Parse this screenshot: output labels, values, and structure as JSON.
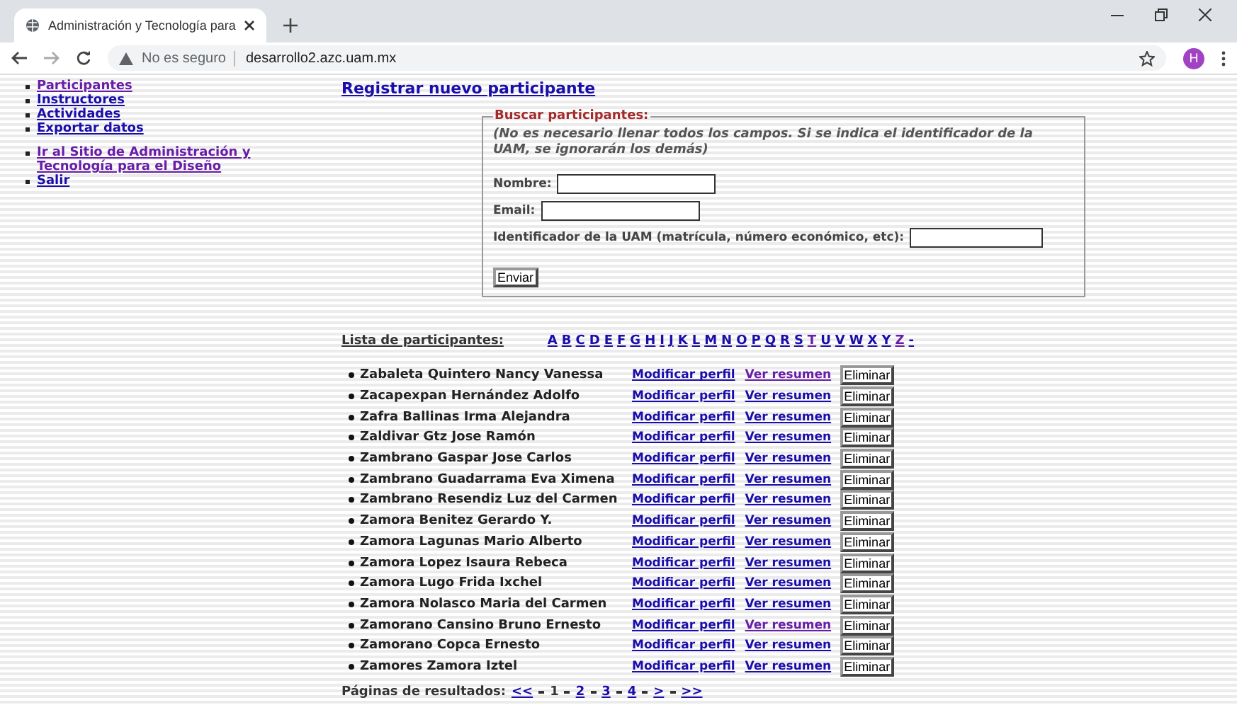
{
  "browser": {
    "tab_title": "Administración y Tecnología para",
    "url_warning": "No es seguro",
    "url": "desarrollo2.azc.uam.mx",
    "profile": "H"
  },
  "nav": {
    "groups": [
      [
        {
          "label": "Participantes",
          "visited": true
        },
        {
          "label": "Instructores",
          "visited": false
        },
        {
          "label": "Actividades",
          "visited": false
        },
        {
          "label": "Exportar datos",
          "visited": false
        }
      ],
      [
        {
          "label": "Ir al Sitio de Administración y Tecnología para el Diseño",
          "visited": true
        },
        {
          "label": "Salir",
          "visited": false
        }
      ]
    ]
  },
  "register_link": "Registrar nuevo participante",
  "search": {
    "legend": "Buscar participantes:",
    "note": "(No es necesario llenar todos los campos. Si se indica el identificador de la UAM, se ignorarán los demás)",
    "fields": [
      {
        "label": "Nombre:"
      },
      {
        "label": "Email:"
      },
      {
        "label": "Identificador de la UAM (matrícula, número económico, etc):"
      }
    ],
    "submit": "Enviar"
  },
  "list_title": "Lista de participantes:",
  "letters": [
    {
      "label": "A",
      "visited": false
    },
    {
      "label": "B",
      "visited": false
    },
    {
      "label": "C",
      "visited": false
    },
    {
      "label": "D",
      "visited": false
    },
    {
      "label": "E",
      "visited": false
    },
    {
      "label": "F",
      "visited": false
    },
    {
      "label": "G",
      "visited": false
    },
    {
      "label": "H",
      "visited": false
    },
    {
      "label": "I",
      "visited": false
    },
    {
      "label": "J",
      "visited": false
    },
    {
      "label": "K",
      "visited": false
    },
    {
      "label": "L",
      "visited": false
    },
    {
      "label": "M",
      "visited": false
    },
    {
      "label": "N",
      "visited": false
    },
    {
      "label": "O",
      "visited": false
    },
    {
      "label": "P",
      "visited": false
    },
    {
      "label": "Q",
      "visited": false
    },
    {
      "label": "R",
      "visited": false
    },
    {
      "label": "S",
      "visited": false
    },
    {
      "label": "T",
      "visited": true
    },
    {
      "label": "U",
      "visited": false
    },
    {
      "label": "V",
      "visited": false
    },
    {
      "label": "W",
      "visited": false
    },
    {
      "label": "X",
      "visited": false
    },
    {
      "label": "Y",
      "visited": false
    },
    {
      "label": "Z",
      "visited": true
    },
    {
      "label": "-",
      "visited": false
    }
  ],
  "participants": [
    {
      "name": "Zabaleta Quintero Nancy Vanessa",
      "edit": "Modificar perfil",
      "summary": "Ver resumen",
      "summary_visited": true,
      "delete": "Eliminar"
    },
    {
      "name": "Zacapexpan Hernández Adolfo",
      "edit": "Modificar perfil",
      "summary": "Ver resumen",
      "summary_visited": false,
      "delete": "Eliminar"
    },
    {
      "name": "Zafra Ballinas Irma Alejandra",
      "edit": "Modificar perfil",
      "summary": "Ver resumen",
      "summary_visited": false,
      "delete": "Eliminar"
    },
    {
      "name": "Zaldivar Gtz Jose Ramón",
      "edit": "Modificar perfil",
      "summary": "Ver resumen",
      "summary_visited": false,
      "delete": "Eliminar"
    },
    {
      "name": "Zambrano Gaspar Jose Carlos",
      "edit": "Modificar perfil",
      "summary": "Ver resumen",
      "summary_visited": false,
      "delete": "Eliminar"
    },
    {
      "name": "Zambrano Guadarrama Eva Ximena",
      "edit": "Modificar perfil",
      "summary": "Ver resumen",
      "summary_visited": false,
      "delete": "Eliminar"
    },
    {
      "name": "Zambrano Resendiz Luz del Carmen",
      "edit": "Modificar perfil",
      "summary": "Ver resumen",
      "summary_visited": false,
      "delete": "Eliminar"
    },
    {
      "name": "Zamora Benitez Gerardo Y.",
      "edit": "Modificar perfil",
      "summary": "Ver resumen",
      "summary_visited": false,
      "delete": "Eliminar"
    },
    {
      "name": "Zamora Lagunas Mario Alberto",
      "edit": "Modificar perfil",
      "summary": "Ver resumen",
      "summary_visited": false,
      "delete": "Eliminar"
    },
    {
      "name": "Zamora Lopez Isaura Rebeca",
      "edit": "Modificar perfil",
      "summary": "Ver resumen",
      "summary_visited": false,
      "delete": "Eliminar"
    },
    {
      "name": "Zamora Lugo Frida Ixchel",
      "edit": "Modificar perfil",
      "summary": "Ver resumen",
      "summary_visited": false,
      "delete": "Eliminar"
    },
    {
      "name": "Zamora Nolasco Maria del Carmen",
      "edit": "Modificar perfil",
      "summary": "Ver resumen",
      "summary_visited": false,
      "delete": "Eliminar"
    },
    {
      "name": "Zamorano Cansino Bruno Ernesto",
      "edit": "Modificar perfil",
      "summary": "Ver resumen",
      "summary_visited": true,
      "delete": "Eliminar"
    },
    {
      "name": "Zamorano Copca Ernesto",
      "edit": "Modificar perfil",
      "summary": "Ver resumen",
      "summary_visited": false,
      "delete": "Eliminar"
    },
    {
      "name": "Zamores Zamora Iztel",
      "edit": "Modificar perfil",
      "summary": "Ver resumen",
      "summary_visited": false,
      "delete": "Eliminar"
    }
  ],
  "pagination": {
    "label": "Páginas de resultados:",
    "items": [
      {
        "label": "<<",
        "kind": "link"
      },
      {
        "label": "1",
        "kind": "current"
      },
      {
        "label": "2",
        "kind": "link"
      },
      {
        "label": "3",
        "kind": "link"
      },
      {
        "label": "4",
        "kind": "link"
      },
      {
        "label": ">",
        "kind": "link"
      },
      {
        "label": ">>",
        "kind": "link"
      }
    ]
  }
}
